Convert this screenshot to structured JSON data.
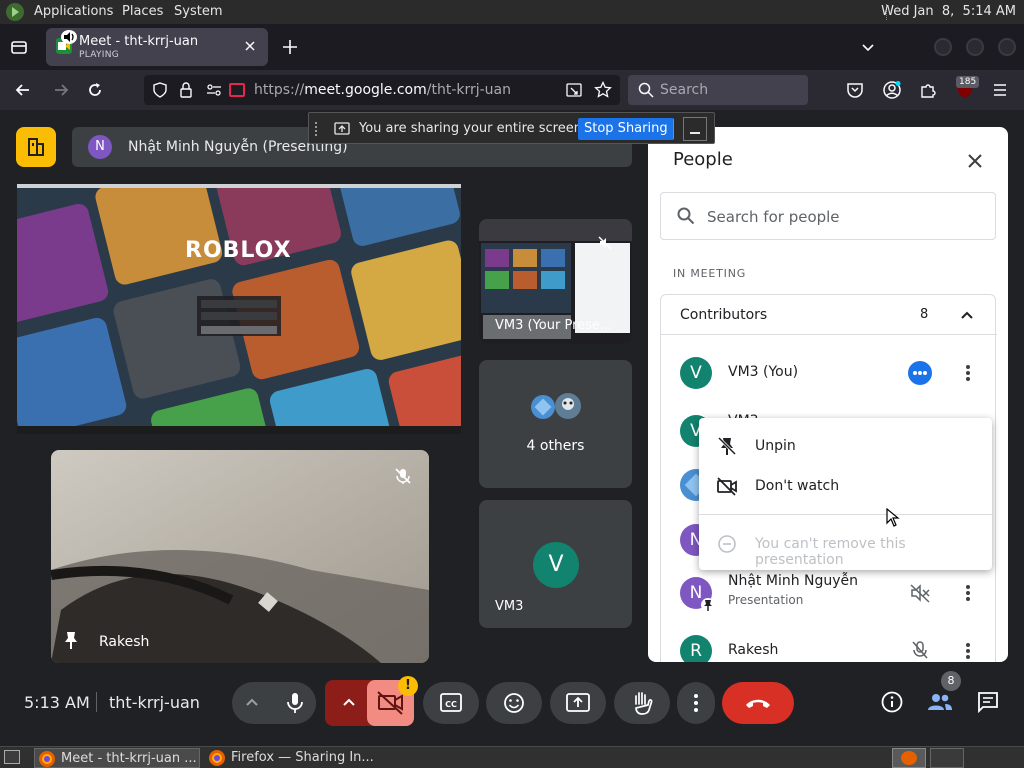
{
  "topbar": {
    "menu": [
      "Applications",
      "Places",
      "System"
    ],
    "clock": "Wed Jan  8,  5:14 AM"
  },
  "browser": {
    "tab_title": "Meet - tht-krrj-uan",
    "tab_status": "PLAYING",
    "url_prefix": "https://",
    "url_domain": "meet.google.com",
    "url_path": "/tht-krrj-uan",
    "search_placeholder": "Search",
    "extensions_badge": "185"
  },
  "sharebar": {
    "message": "You are sharing your entire screen.",
    "stop_label": "Stop Sharing"
  },
  "meet": {
    "presenter_initial": "N",
    "presenter_banner": "Nhật Minh Nguyễn (Presenting)",
    "roblox_logo": "ROBLOX",
    "tile_self_label": "VM3 (Your Prese...",
    "others_label": "4 others",
    "vm3_initial": "V",
    "vm3_label": "VM3",
    "rakesh_label": "Rakesh",
    "meeting_time": "5:13 AM",
    "meeting_code": "tht-krrj-uan",
    "people_count_badge": "8",
    "alert_badge": "!"
  },
  "people": {
    "title": "People",
    "search_placeholder": "Search for people",
    "section_label": "IN MEETING",
    "group_label": "Contributors",
    "group_count": "8",
    "rows": [
      {
        "initial": "V",
        "name": "VM3 (You)",
        "sub": "",
        "color": "#12836e"
      },
      {
        "initial": "V",
        "name": "VM3",
        "sub": "",
        "color": "#12836e"
      },
      {
        "initial": "N",
        "name": "Nhật Minh Nguyễn",
        "sub": "Presentation",
        "color": "#7e57c2"
      },
      {
        "initial": "R",
        "name": "Rakesh",
        "sub": "",
        "color": "#12836e"
      }
    ]
  },
  "context_menu": {
    "unpin": "Unpin",
    "dont_watch": "Don't watch",
    "remove_disabled": "You can't remove this presentation"
  },
  "taskbar": {
    "items": [
      "Meet - tht-krrj-uan ...",
      "Firefox — Sharing In..."
    ]
  },
  "colors": {
    "meet_bg": "#202124",
    "tile_bg": "#3c4043",
    "accent_blue": "#1a73e8",
    "end_call_red": "#d93025",
    "camera_off_red": "#f28b82",
    "presenter_yellow": "#fbbc04"
  }
}
